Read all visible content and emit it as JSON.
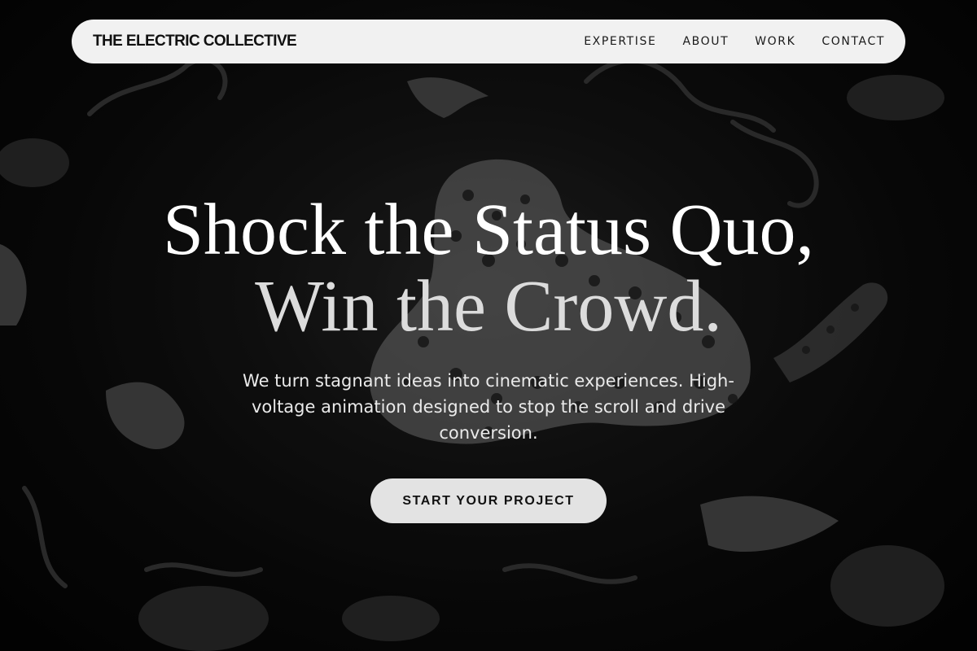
{
  "nav": {
    "brand": "THE ELECTRIC COLLECTIVE",
    "links": [
      {
        "label": "EXPERTISE"
      },
      {
        "label": "ABOUT"
      },
      {
        "label": "WORK"
      },
      {
        "label": "CONTACT"
      }
    ]
  },
  "hero": {
    "headline_line1": "Shock the Status Quo,",
    "headline_line2": "Win the Crowd.",
    "subtext": "We turn stagnant ideas into cinematic experiences. High-voltage animation designed to stop the scroll and drive conversion.",
    "cta_label": "START YOUR PROJECT"
  },
  "colors": {
    "background": "#050505",
    "nav_background": "#f1f1f1",
    "cta_background": "#e3e3e3",
    "text_primary": "#ffffff"
  }
}
